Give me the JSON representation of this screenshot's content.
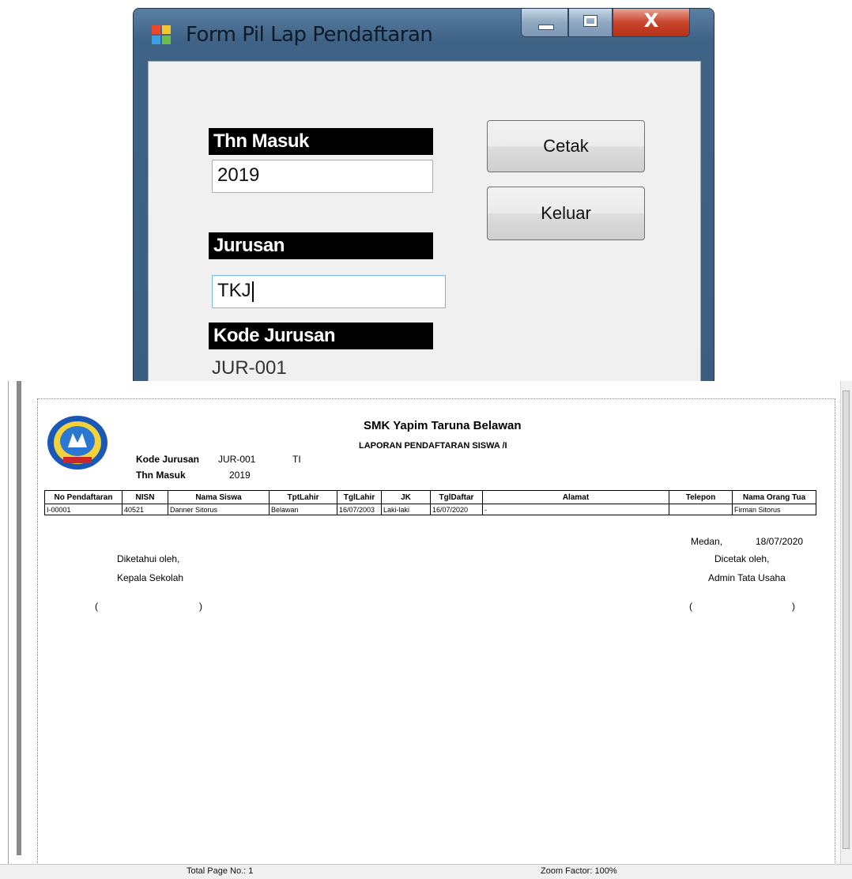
{
  "form": {
    "title": "Form Pil Lap Pendaftaran",
    "close_glyph": "X",
    "thn_masuk_label": "Thn Masuk",
    "thn_masuk_value": "2019",
    "jurusan_label": "Jurusan",
    "jurusan_value": "TKJ",
    "kode_jurusan_label": "Kode Jurusan",
    "kode_jurusan_value": "JUR-001",
    "cetak_label": "Cetak",
    "keluar_label": "Keluar"
  },
  "report": {
    "school": "SMK Yapim Taruna Belawan",
    "title": "LAPORAN PENDAFTARAN SISWA  /I",
    "kode_jurusan_label": "Kode Jurusan",
    "kode_jurusan_value": "JUR-001",
    "jurusan_short": "TI",
    "thn_masuk_label": "Thn Masuk",
    "thn_masuk_value": "2019",
    "columns": [
      "No Pendaftaran",
      "NISN",
      "Nama Siswa",
      "TptLahir",
      "TglLahir",
      "JK",
      "TglDaftar",
      "Alamat",
      "Telepon",
      "Nama Orang Tua"
    ],
    "rows": [
      [
        "I-00001",
        "40521",
        "Danner Sitorus",
        "Belawan",
        "16/07/2003",
        "Laki-laki",
        "16/07/2020",
        "-",
        "",
        "Firman Sitorus"
      ]
    ],
    "diketahui": "Diketahui oleh,",
    "kepala": "Kepala Sekolah",
    "medan": "Medan,",
    "tanggal": "18/07/2020",
    "dicetak": "Dicetak oleh,",
    "admin": "Admin Tata Usaha",
    "paren_open": "(",
    "paren_close": ")"
  },
  "statusbar": {
    "total_pages": "Total Page No.: 1",
    "zoom": "Zoom Factor: 100%"
  }
}
